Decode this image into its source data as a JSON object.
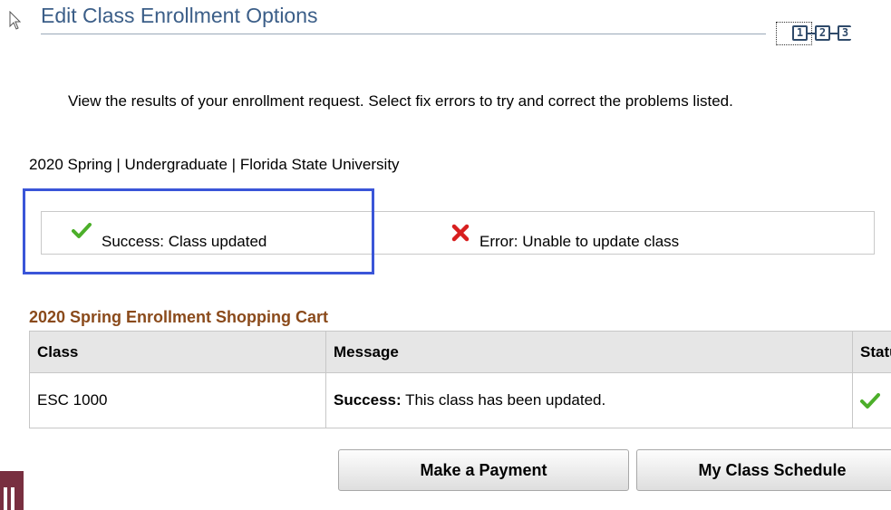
{
  "header": {
    "title": "Edit Class Enrollment Options",
    "steps": [
      "1",
      "2",
      "3"
    ]
  },
  "intro_text": "View the results of your enrollment request.  Select fix errors to try and correct the problems listed.",
  "term_info": "2020 Spring | Undergraduate | Florida State University",
  "status_legend": {
    "success_label": "Success:  Class updated",
    "error_label": "Error: Unable to update class"
  },
  "cart": {
    "title": "2020 Spring Enrollment Shopping Cart",
    "columns": [
      "Class",
      "Message",
      "Status"
    ],
    "rows": [
      {
        "class": "ESC 1000",
        "message_prefix": "Success:",
        "message": " This class has been updated.",
        "status_icon": "check-icon"
      }
    ]
  },
  "buttons": {
    "payment": "Make a Payment",
    "schedule": "My Class Schedule"
  },
  "colors": {
    "title": "#3b5e88",
    "section_heading": "#8a4a1b",
    "success": "#4caf2a",
    "error": "#d81f1f",
    "highlight": "#3a55d8",
    "side_tab": "#782f40"
  }
}
